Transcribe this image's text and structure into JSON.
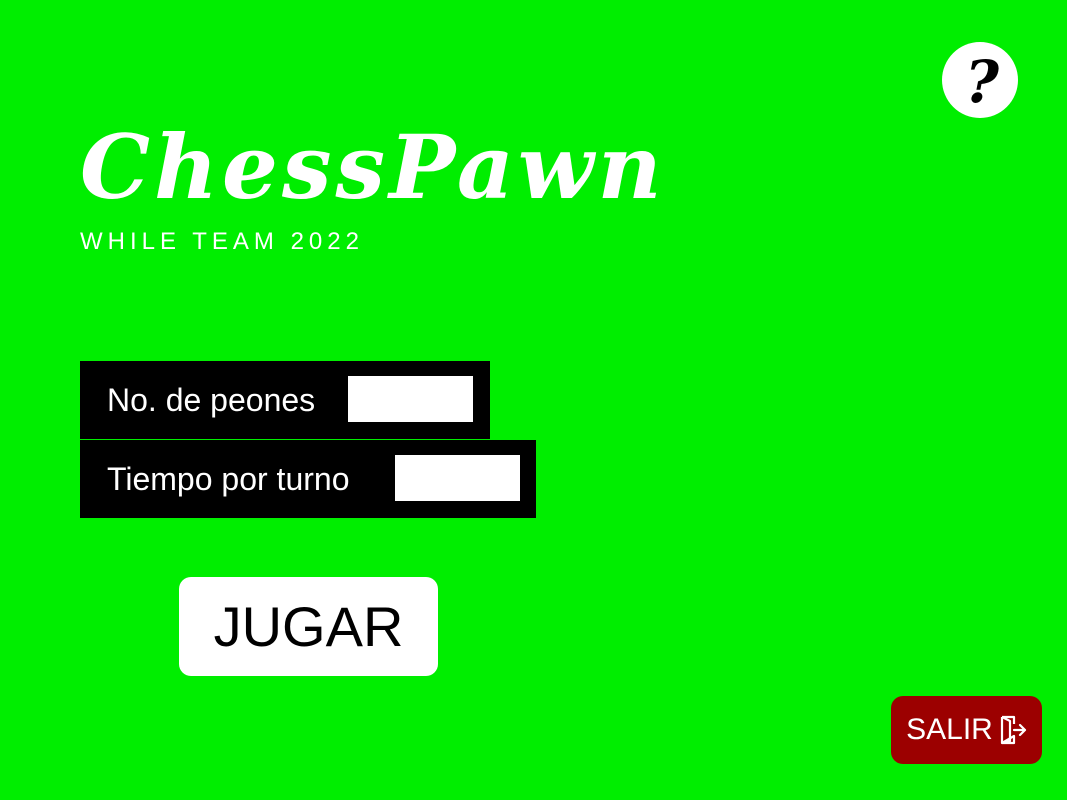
{
  "app": {
    "title": "ChessPawn",
    "subtitle": "WHILE TEAM 2022"
  },
  "help_button": {
    "label": "?",
    "icon": "question-mark-icon"
  },
  "settings": {
    "pawns": {
      "label": "No. de peones",
      "value": "",
      "placeholder": ""
    },
    "turn_time": {
      "label": "Tiempo por turno",
      "value": "",
      "placeholder": ""
    }
  },
  "play_button": {
    "label": "JUGAR"
  },
  "exit_button": {
    "label": "SALIR",
    "icon": "exit-door-icon"
  },
  "colors": {
    "background": "#00ee00",
    "panel": "#000000",
    "exit_button": "#9c0000",
    "text_light": "#ffffff"
  }
}
